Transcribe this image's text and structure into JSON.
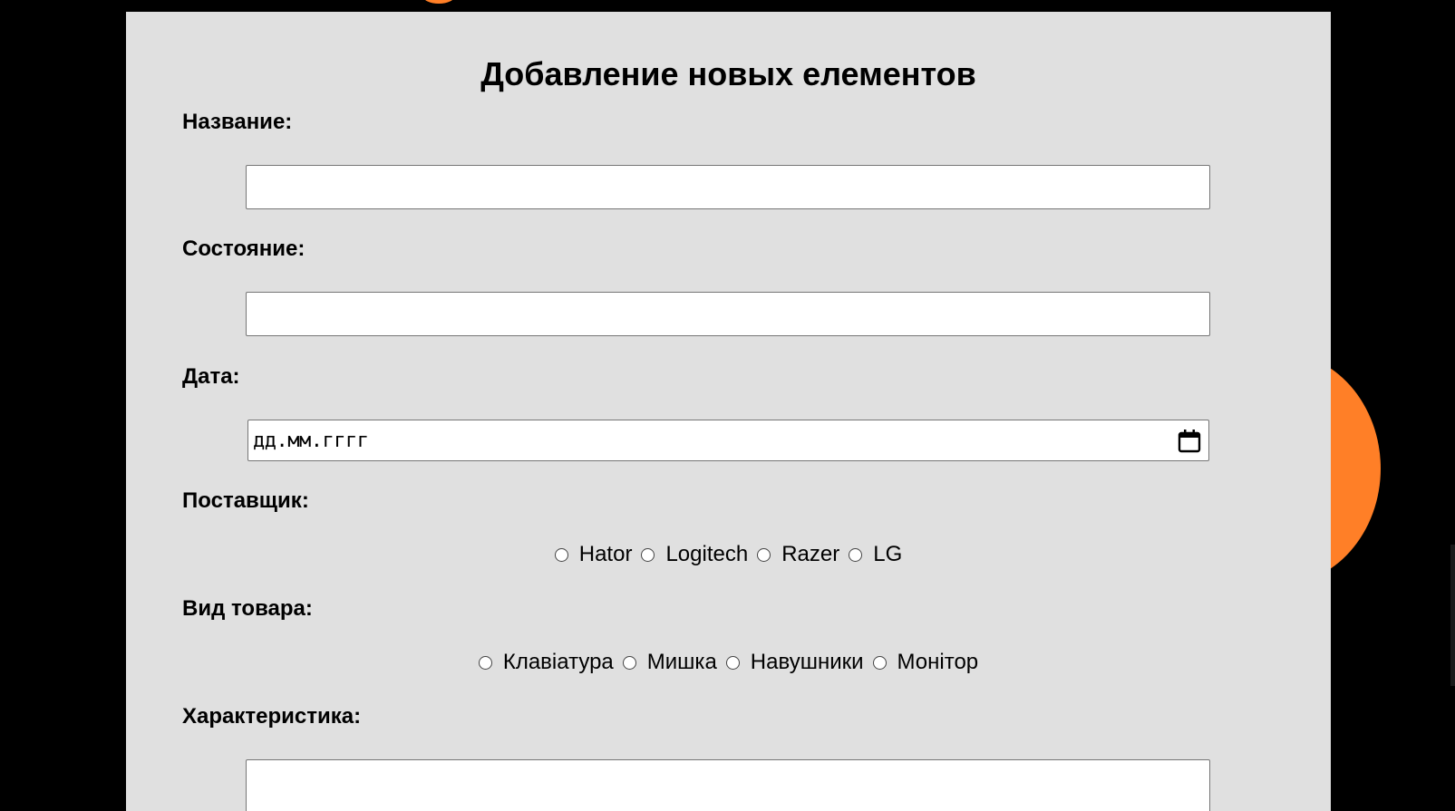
{
  "form": {
    "title": "Добавление новых елементов",
    "fields": {
      "name_label": "Название:",
      "state_label": "Состояние:",
      "date_label": "Дата:",
      "date_placeholder": "дд.мм.гггг",
      "supplier_label": "Поставщик:",
      "product_type_label": "Вид товара:",
      "characteristic_label": "Характеристика:"
    },
    "suppliers": [
      "Hator",
      "Logitech",
      "Razer",
      "LG"
    ],
    "product_types": [
      "Клавіатура",
      "Мишка",
      "Навушники",
      "Монітор"
    ]
  },
  "colors": {
    "panel_background": "#e0e0e0",
    "page_background": "#000000",
    "accent_orange": "#ff7f27"
  }
}
